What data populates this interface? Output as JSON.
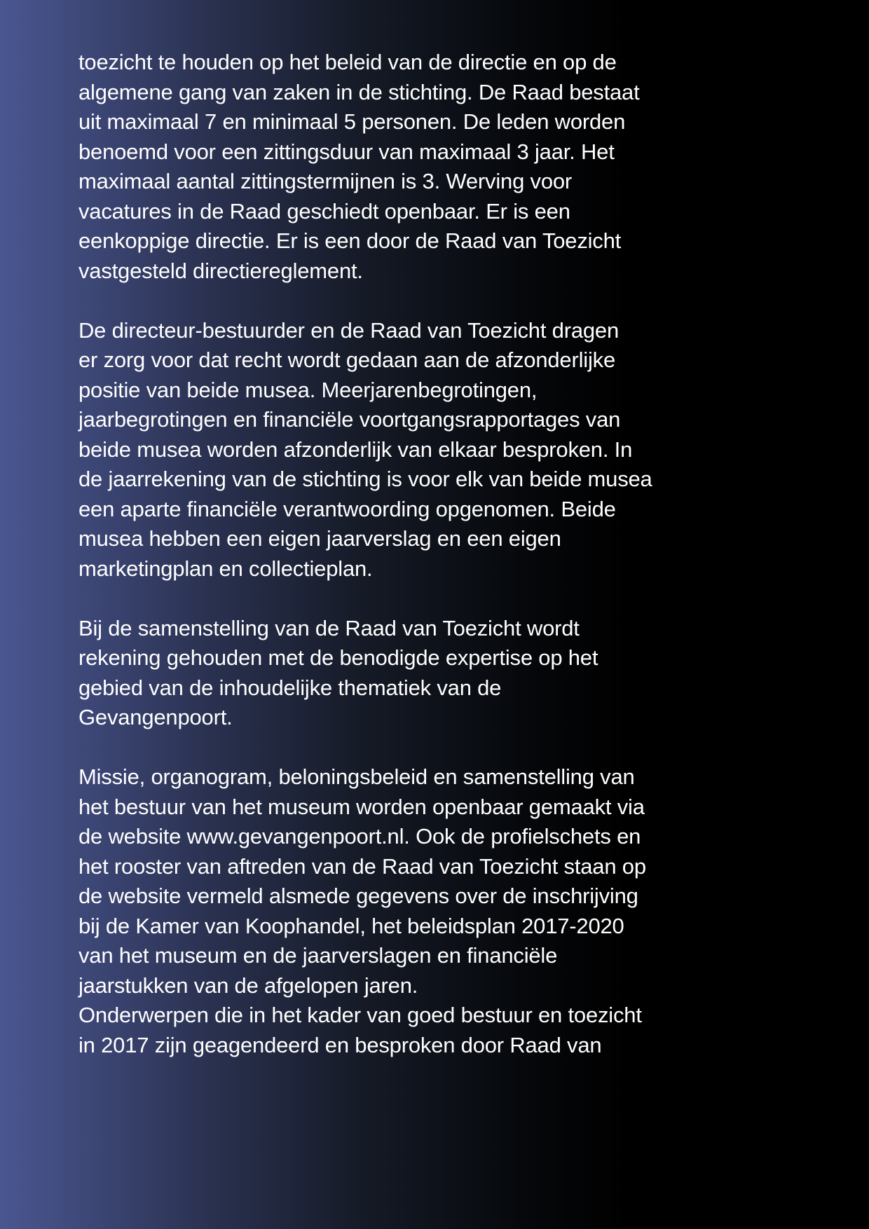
{
  "document": {
    "paragraphs": [
      {
        "lines": [
          "toezicht te houden op het beleid van de directie en op de",
          "algemene gang van zaken in de stichting. De Raad bestaat",
          "uit maximaal 7 en minimaal 5 personen. De leden worden",
          "benoemd voor een zittingsduur van maximaal 3 jaar. Het",
          "maximaal aantal zittingstermijnen is 3. Werving voor",
          "vacatures in de Raad geschiedt openbaar. Er is een",
          "eenkoppige directie. Er is een door de Raad van Toezicht",
          "vastgesteld directiereglement."
        ]
      },
      {
        "lines": [
          "De directeur-bestuurder en de Raad van Toezicht dragen",
          "er zorg voor dat recht wordt gedaan aan de afzonderlijke",
          "positie van beide musea. Meerjarenbegrotingen,",
          "jaarbegrotingen en financiële voortgangsrapportages van",
          "beide musea worden afzonderlijk van elkaar besproken. In",
          "de jaarrekening van de stichting is voor elk van beide musea",
          "een aparte financiële verantwoording opgenomen. Beide",
          "musea hebben een eigen jaarverslag en een eigen",
          "marketingplan en collectieplan."
        ]
      },
      {
        "lines": [
          "Bij de samenstelling van de Raad van Toezicht wordt",
          "rekening gehouden met de benodigde expertise op het",
          "gebied van de inhoudelijke thematiek van de",
          "Gevangenpoort."
        ]
      },
      {
        "lines": [
          "Missie, organogram, beloningsbeleid en samenstelling van",
          "het bestuur van het museum worden openbaar gemaakt via",
          "de website www.gevangenpoort.nl. Ook de profielschets en",
          "het rooster van aftreden van de Raad van Toezicht staan op",
          "de website vermeld alsmede gegevens over de inschrijving",
          "bij de Kamer van Koophandel, het beleidsplan 2017-2020",
          "van het museum en de jaarverslagen en financiële",
          "jaarstukken van de afgelopen jaren.",
          "Onderwerpen die in het kader van goed bestuur en toezicht",
          "in 2017 zijn geagendeerd en besproken door Raad van"
        ]
      }
    ]
  }
}
